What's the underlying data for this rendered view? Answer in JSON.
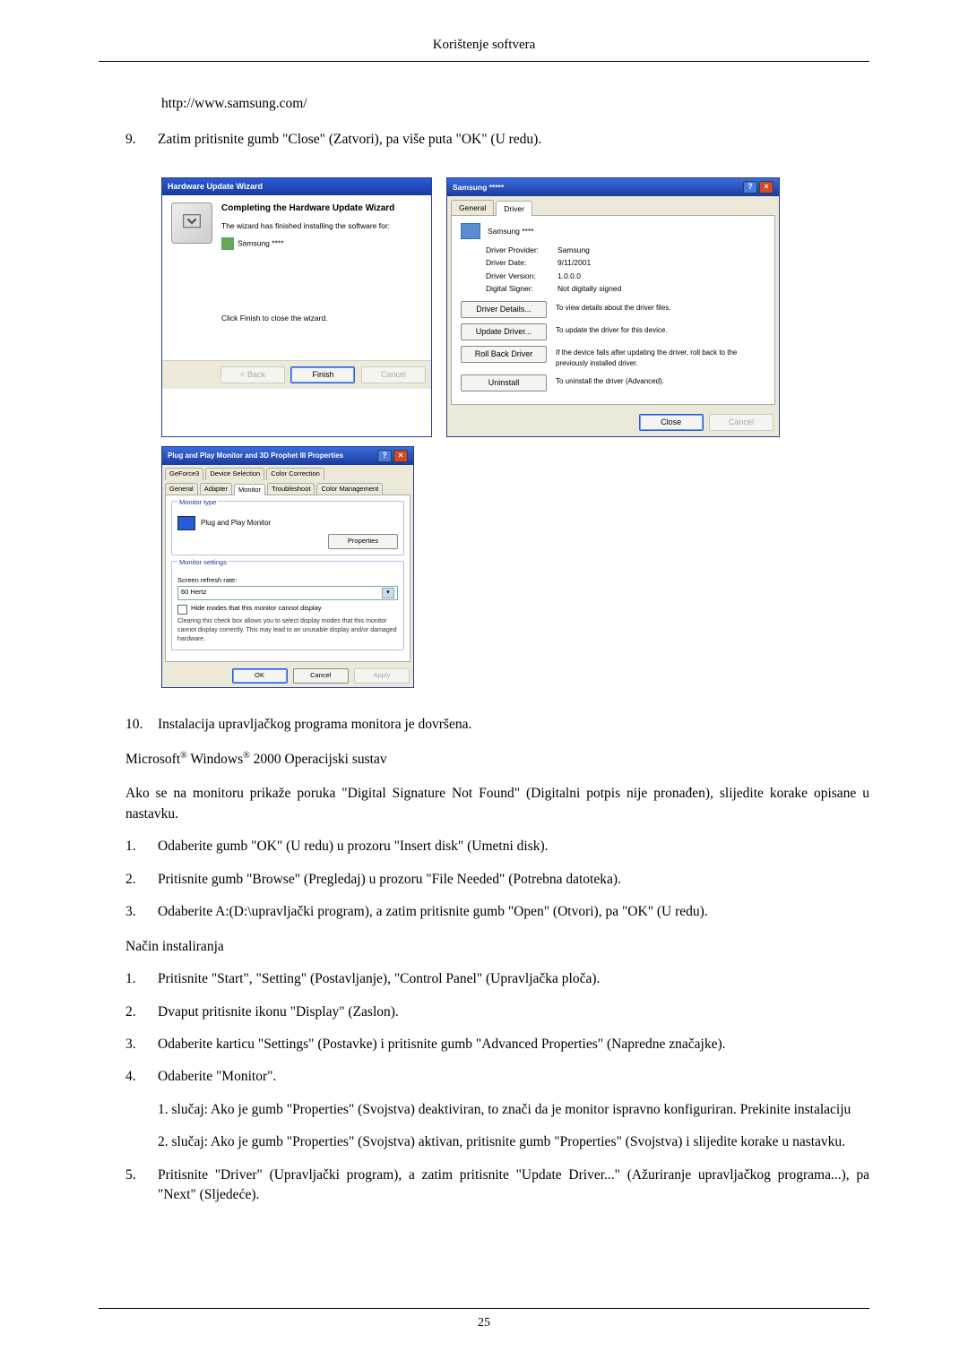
{
  "header": {
    "title": "Korištenje softvera"
  },
  "url": "http://www.samsung.com/",
  "step9": {
    "num": "9.",
    "text": "Zatim pritisnite gumb \"Close\" (Zatvori), pa više puta \"OK\" (U redu)."
  },
  "wizard": {
    "title": "Hardware Update Wizard",
    "heading": "Completing the Hardware Update Wizard",
    "line1": "The wizard has finished installing the software for:",
    "device": "Samsung ****",
    "finish_note": "Click Finish to close the wizard.",
    "btn_back": "< Back",
    "btn_finish": "Finish",
    "btn_cancel": "Cancel"
  },
  "driver": {
    "title": "Samsung *****",
    "tab_general": "General",
    "tab_driver": "Driver",
    "device": "Samsung ****",
    "kv": {
      "provider_k": "Driver Provider:",
      "provider_v": "Samsung",
      "date_k": "Driver Date:",
      "date_v": "9/11/2001",
      "version_k": "Driver Version:",
      "version_v": "1.0.0.0",
      "signer_k": "Digital Signer:",
      "signer_v": "Not digitally signed"
    },
    "rows": {
      "details_btn": "Driver Details...",
      "details_desc": "To view details about the driver files.",
      "update_btn": "Update Driver...",
      "update_desc": "To update the driver for this device.",
      "rollback_btn": "Roll Back Driver",
      "rollback_desc": "If the device fails after updating the driver, roll back to the previously installed driver.",
      "uninstall_btn": "Uninstall",
      "uninstall_desc": "To uninstall the driver (Advanced)."
    },
    "btn_close": "Close",
    "btn_cancel": "Cancel"
  },
  "monitor": {
    "title": "Plug and Play Monitor and 3D Prophet III Properties",
    "tabs": {
      "geforce": "GeForce3",
      "devsel": "Device Selection",
      "color": "Color Correction",
      "general": "General",
      "adapter": "Adapter",
      "mon": "Monitor",
      "trouble": "Troubleshoot",
      "cm": "Color Management"
    },
    "grp_type": "Monitor type",
    "pnp": "Plug and Play Monitor",
    "btn_props": "Properties",
    "grp_settings": "Monitor settings",
    "refresh_label": "Screen refresh rate:",
    "refresh_val": "60 Hertz",
    "hide": "Hide modes that this monitor cannot display",
    "hide_note": "Clearing this check box allows you to select display modes that this monitor cannot display correctly. This may lead to an unusable display and/or damaged hardware.",
    "btn_ok": "OK",
    "btn_cancel": "Cancel",
    "btn_apply": "Apply"
  },
  "step10": {
    "num": "10.",
    "text": "Instalacija upravljačkog programa monitora je dovršena."
  },
  "os_line": {
    "pre": "Microsoft",
    "reg1": "®",
    "mid": " Windows",
    "reg2": "®",
    "post": " 2000 Operacijski sustav"
  },
  "sig_para": "Ako se na monitoru prikaže poruka \"Digital Signature Not Found\" (Digitalni potpis nije pronađen), slijedite korake opisane u nastavku.",
  "listA": [
    {
      "num": "1.",
      "text": "Odaberite gumb \"OK\" (U redu) u prozoru \"Insert disk\" (Umetni disk)."
    },
    {
      "num": "2.",
      "text": "Pritisnite gumb \"Browse\" (Pregledaj) u prozoru \"File Needed\" (Potrebna datoteka)."
    },
    {
      "num": "3.",
      "text": "Odaberite A:(D:\\upravljački program), a zatim pritisnite gumb \"Open\" (Otvori), pa \"OK\" (U redu)."
    }
  ],
  "install_heading": "Način instaliranja",
  "listB": [
    {
      "num": "1.",
      "text": "Pritisnite \"Start\", \"Setting\" (Postavljanje), \"Control Panel\" (Upravljačka ploča)."
    },
    {
      "num": "2.",
      "text": "Dvaput pritisnite ikonu \"Display\" (Zaslon)."
    },
    {
      "num": "3.",
      "text": "Odaberite karticu \"Settings\" (Postavke) i pritisnite gumb \"Advanced Properties\" (Napredne značajke)."
    },
    {
      "num": "4.",
      "text": "Odaberite \"Monitor\".",
      "subs": [
        "1. slučaj: Ako je gumb \"Properties\" (Svojstva) deaktiviran, to znači da je monitor ispravno konfiguriran. Prekinite instalaciju",
        "2. slučaj: Ako je gumb \"Properties\" (Svojstva) aktivan, pritisnite gumb \"Properties\" (Svojstva) i slijedite korake u nastavku."
      ]
    },
    {
      "num": "5.",
      "text": "Pritisnite \"Driver\" (Upravljački program), a zatim pritisnite \"Update Driver...\" (Ažuriranje upravljačkog programa...), pa \"Next\" (Sljedeće)."
    }
  ],
  "footer": {
    "page": "25"
  }
}
